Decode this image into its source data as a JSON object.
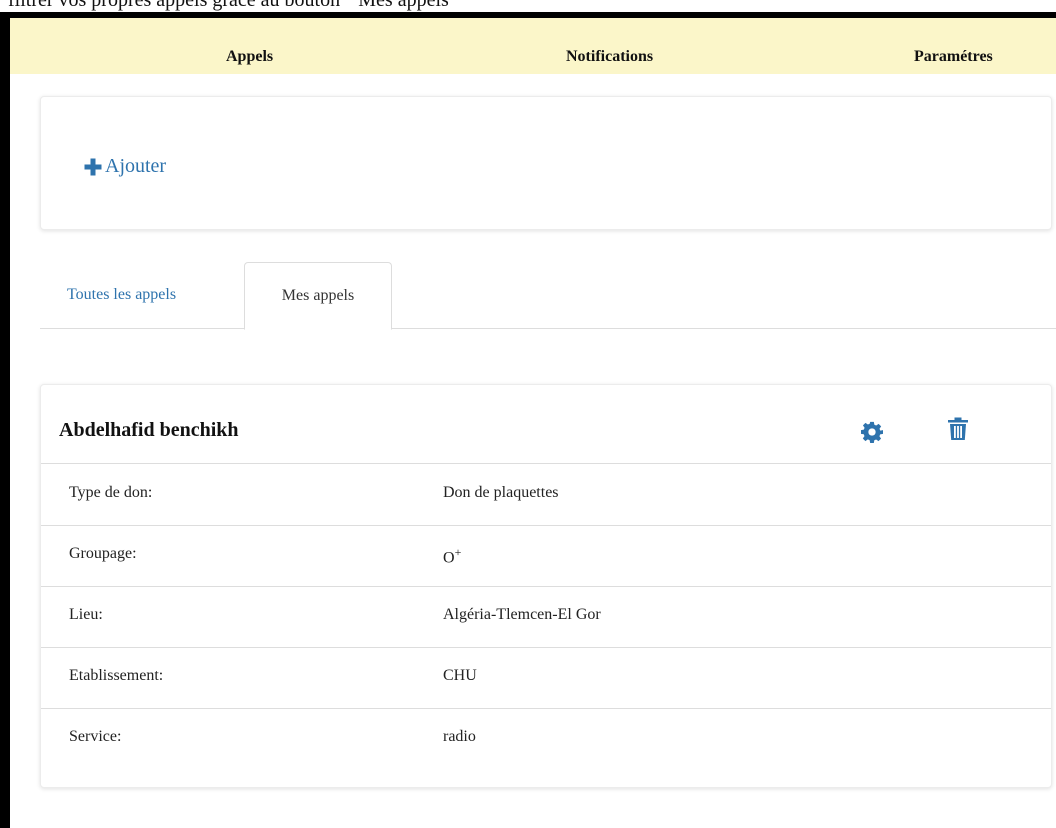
{
  "caption": "filtrer vos propres appels grâce au bouton \" Mes appels \"",
  "nav": {
    "appels": "Appels",
    "notifications": "Notifications",
    "parametres": "Paramétres"
  },
  "add_button": {
    "label": "Ajouter",
    "icon": "plus-icon"
  },
  "tabs": {
    "all": "Toutes les appels",
    "mine": "Mes appels",
    "active": "mine"
  },
  "card": {
    "name": "Abdelhafid benchikh",
    "actions": [
      "gear-icon",
      "trash-icon"
    ],
    "rows": [
      {
        "label": "Type de don:",
        "value": "Don de plaquettes"
      },
      {
        "label": "Groupage:",
        "value": "O",
        "value_sup": "+"
      },
      {
        "label": "Lieu:",
        "value": "Algéria-Tlemcen-El Gor"
      },
      {
        "label": "Etablissement:",
        "value": "CHU"
      },
      {
        "label": "Service:",
        "value": "radio"
      }
    ]
  },
  "colors": {
    "accent": "#2e73ad",
    "topbar": "#fbf6c9"
  }
}
